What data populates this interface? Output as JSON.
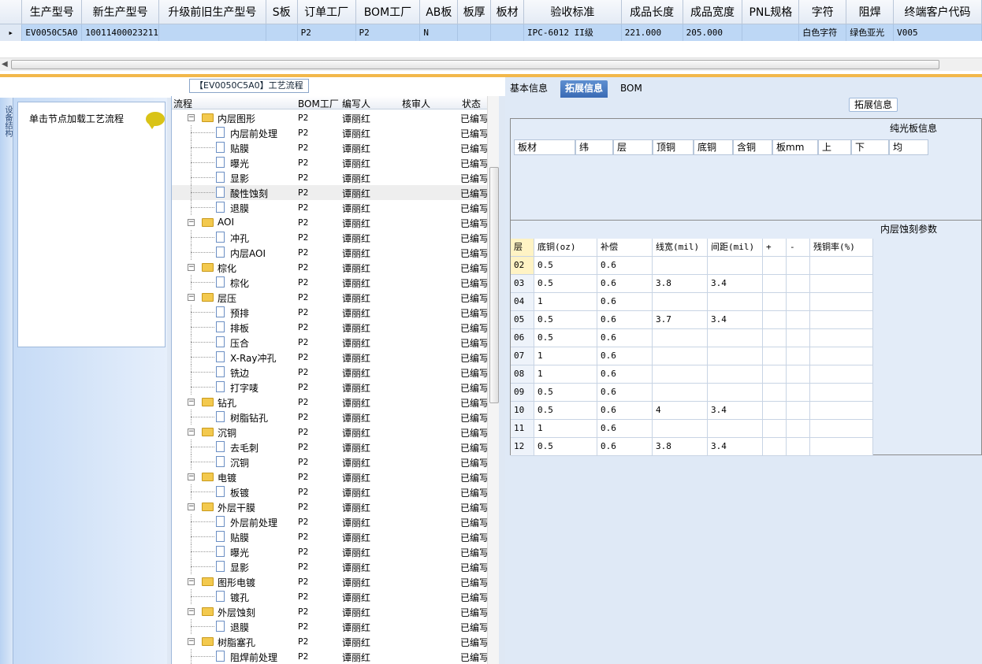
{
  "top_grid": {
    "headers": [
      "生产型号",
      "新生产型号",
      "升级前旧生产型号",
      "S板",
      "订单工厂",
      "BOM工厂",
      "AB板",
      "板厚",
      "板材",
      "验收标准",
      "成品长度",
      "成品宽度",
      "PNL规格",
      "字符",
      "阻焊",
      "终端客户代码"
    ],
    "row": [
      "EV0050C5A0",
      "10011400023211",
      "",
      "",
      "P2",
      "P2",
      "N",
      "",
      "",
      "IPC-6012 II级",
      "221.000",
      "205.000",
      "",
      "白色字符",
      "绿色亚光",
      "V005"
    ]
  },
  "side_tab_label": "设备结构",
  "left_panel": {
    "hint": "单击节点加载工艺流程"
  },
  "flow_title": "【EV0050C5A0】工艺流程",
  "tree": {
    "columns": [
      "流程",
      "BOM工厂",
      "编写人",
      "核审人",
      "状态"
    ],
    "rows": [
      {
        "name": "内层图形",
        "level": 0,
        "bom": "P2",
        "writer": "谭丽红",
        "status": "已编写"
      },
      {
        "name": "内层前处理",
        "level": 1,
        "bom": "P2",
        "writer": "谭丽红",
        "status": "已编写"
      },
      {
        "name": "贴膜",
        "level": 1,
        "bom": "P2",
        "writer": "谭丽红",
        "status": "已编写"
      },
      {
        "name": "曝光",
        "level": 1,
        "bom": "P2",
        "writer": "谭丽红",
        "status": "已编写"
      },
      {
        "name": "显影",
        "level": 1,
        "bom": "P2",
        "writer": "谭丽红",
        "status": "已编写"
      },
      {
        "name": "酸性蚀刻",
        "level": 1,
        "bom": "P2",
        "writer": "谭丽红",
        "status": "已编写",
        "selected": true
      },
      {
        "name": "退膜",
        "level": 1,
        "bom": "P2",
        "writer": "谭丽红",
        "status": "已编写"
      },
      {
        "name": "AOI",
        "level": 0,
        "bom": "P2",
        "writer": "谭丽红",
        "status": "已编写"
      },
      {
        "name": "冲孔",
        "level": 1,
        "bom": "P2",
        "writer": "谭丽红",
        "status": "已编写"
      },
      {
        "name": "内层AOI",
        "level": 1,
        "bom": "P2",
        "writer": "谭丽红",
        "status": "已编写"
      },
      {
        "name": "棕化",
        "level": 0,
        "bom": "P2",
        "writer": "谭丽红",
        "status": "已编写"
      },
      {
        "name": "棕化",
        "level": 1,
        "bom": "P2",
        "writer": "谭丽红",
        "status": "已编写"
      },
      {
        "name": "层压",
        "level": 0,
        "bom": "P2",
        "writer": "谭丽红",
        "status": "已编写"
      },
      {
        "name": "预排",
        "level": 1,
        "bom": "P2",
        "writer": "谭丽红",
        "status": "已编写"
      },
      {
        "name": "排板",
        "level": 1,
        "bom": "P2",
        "writer": "谭丽红",
        "status": "已编写"
      },
      {
        "name": "压合",
        "level": 1,
        "bom": "P2",
        "writer": "谭丽红",
        "status": "已编写"
      },
      {
        "name": "X-Ray冲孔",
        "level": 1,
        "bom": "P2",
        "writer": "谭丽红",
        "status": "已编写"
      },
      {
        "name": "铣边",
        "level": 1,
        "bom": "P2",
        "writer": "谭丽红",
        "status": "已编写"
      },
      {
        "name": "打字唛",
        "level": 1,
        "bom": "P2",
        "writer": "谭丽红",
        "status": "已编写"
      },
      {
        "name": "钻孔",
        "level": 0,
        "bom": "P2",
        "writer": "谭丽红",
        "status": "已编写"
      },
      {
        "name": "树脂钻孔",
        "level": 1,
        "bom": "P2",
        "writer": "谭丽红",
        "status": "已编写"
      },
      {
        "name": "沉铜",
        "level": 0,
        "bom": "P2",
        "writer": "谭丽红",
        "status": "已编写"
      },
      {
        "name": "去毛刺",
        "level": 1,
        "bom": "P2",
        "writer": "谭丽红",
        "status": "已编写"
      },
      {
        "name": "沉铜",
        "level": 1,
        "bom": "P2",
        "writer": "谭丽红",
        "status": "已编写"
      },
      {
        "name": "电镀",
        "level": 0,
        "bom": "P2",
        "writer": "谭丽红",
        "status": "已编写"
      },
      {
        "name": "板镀",
        "level": 1,
        "bom": "P2",
        "writer": "谭丽红",
        "status": "已编写"
      },
      {
        "name": "外层干膜",
        "level": 0,
        "bom": "P2",
        "writer": "谭丽红",
        "status": "已编写"
      },
      {
        "name": "外层前处理",
        "level": 1,
        "bom": "P2",
        "writer": "谭丽红",
        "status": "已编写"
      },
      {
        "name": "贴膜",
        "level": 1,
        "bom": "P2",
        "writer": "谭丽红",
        "status": "已编写"
      },
      {
        "name": "曝光",
        "level": 1,
        "bom": "P2",
        "writer": "谭丽红",
        "status": "已编写"
      },
      {
        "name": "显影",
        "level": 1,
        "bom": "P2",
        "writer": "谭丽红",
        "status": "已编写"
      },
      {
        "name": "图形电镀",
        "level": 0,
        "bom": "P2",
        "writer": "谭丽红",
        "status": "已编写"
      },
      {
        "name": "镀孔",
        "level": 1,
        "bom": "P2",
        "writer": "谭丽红",
        "status": "已编写"
      },
      {
        "name": "外层蚀刻",
        "level": 0,
        "bom": "P2",
        "writer": "谭丽红",
        "status": "已编写"
      },
      {
        "name": "退膜",
        "level": 1,
        "bom": "P2",
        "writer": "谭丽红",
        "status": "已编写"
      },
      {
        "name": "树脂塞孔",
        "level": 0,
        "bom": "P2",
        "writer": "谭丽红",
        "status": "已编写"
      },
      {
        "name": "阻焊前处理",
        "level": 1,
        "bom": "P2",
        "writer": "谭丽红",
        "status": "已编写"
      }
    ]
  },
  "right_panel": {
    "tabs": [
      "基本信息",
      "拓展信息",
      "BOM"
    ],
    "active_tab": "拓展信息",
    "ext_label": "拓展信息",
    "pure_board": {
      "title": "纯光板信息",
      "columns": [
        "板材",
        "纬",
        "层",
        "顶铜",
        "底铜",
        "含铜",
        "板mm",
        "上",
        "下",
        "均"
      ]
    },
    "inner_etch": {
      "title": "内层蚀刻参数",
      "columns": [
        "层",
        "底铜(oz)",
        "补偿",
        "线宽(mil)",
        "间距(mil)",
        "+",
        "-",
        "残铜率(%)"
      ],
      "rows": [
        [
          "02",
          "0.5",
          "0.6",
          "",
          "",
          "",
          "",
          ""
        ],
        [
          "03",
          "0.5",
          "0.6",
          "3.8",
          "3.4",
          "",
          "",
          ""
        ],
        [
          "04",
          "1",
          "0.6",
          "",
          "",
          "",
          "",
          ""
        ],
        [
          "05",
          "0.5",
          "0.6",
          "3.7",
          "3.4",
          "",
          "",
          ""
        ],
        [
          "06",
          "0.5",
          "0.6",
          "",
          "",
          "",
          "",
          ""
        ],
        [
          "07",
          "1",
          "0.6",
          "",
          "",
          "",
          "",
          ""
        ],
        [
          "08",
          "1",
          "0.6",
          "",
          "",
          "",
          "",
          ""
        ],
        [
          "09",
          "0.5",
          "0.6",
          "",
          "",
          "",
          "",
          ""
        ],
        [
          "10",
          "0.5",
          "0.6",
          "4",
          "3.4",
          "",
          "",
          ""
        ],
        [
          "11",
          "1",
          "0.6",
          "",
          "",
          "",
          "",
          ""
        ],
        [
          "12",
          "0.5",
          "0.6",
          "3.8",
          "3.4",
          "",
          "",
          ""
        ]
      ]
    }
  }
}
